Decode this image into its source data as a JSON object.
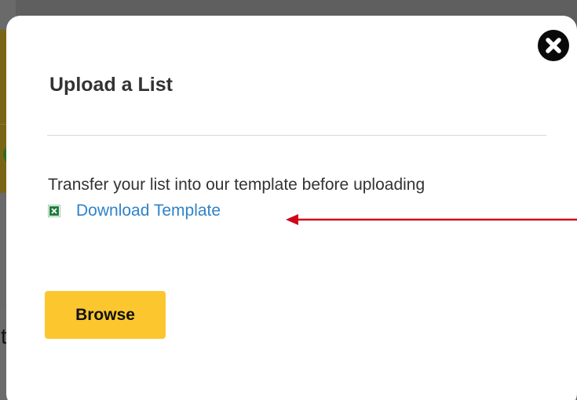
{
  "background": {
    "partial_char": "t"
  },
  "modal": {
    "title": "Upload a List",
    "instructions": "Transfer your list into our template before uploading",
    "template_link_label": "Download Template",
    "browse_label": "Browse",
    "close_icon": "close-icon",
    "file_icon": "excel-file-icon"
  },
  "colors": {
    "accent_button": "#fcc62e",
    "link": "#2f83c9",
    "annotation_arrow": "#d0021b",
    "excel_green": "#1d7a3a"
  }
}
